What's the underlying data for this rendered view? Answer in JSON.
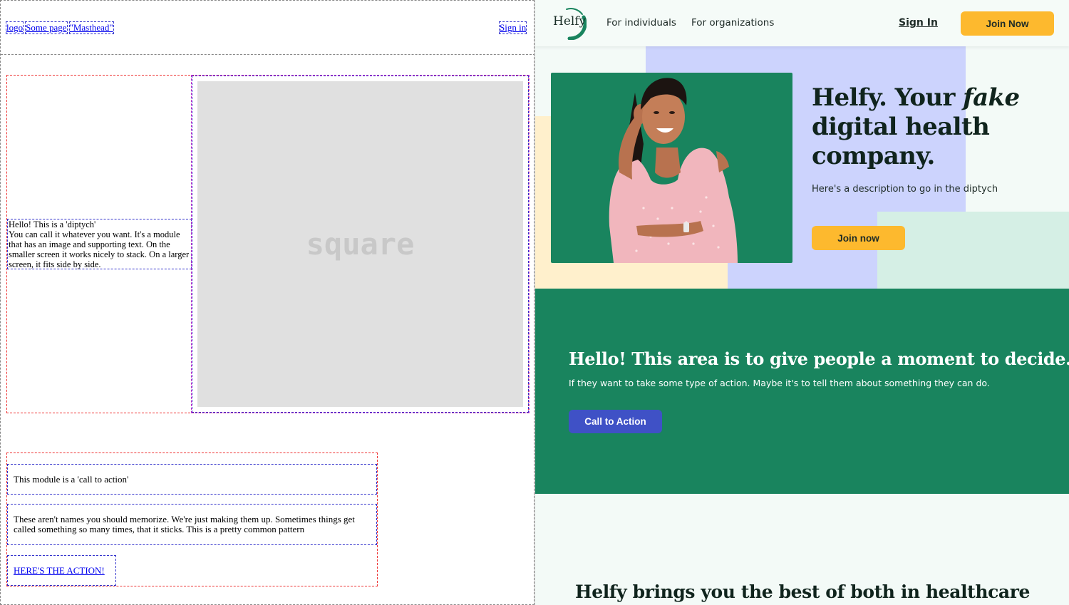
{
  "wireframe": {
    "nav": [
      "logo",
      "Some page",
      "\"Masthead\""
    ],
    "sign_in": "Sign in",
    "diptych_text": "Hello! This is a 'diptych'\nYou can call it whatever you want. It's a module that has an image and supporting text. On the smaller screen it works nicely to stack. On a larger screen, it fits side by side.",
    "square_label": "square",
    "cta_title": "This module is a 'call to action'",
    "cta_body": "These aren't names you should memorize. We're just making them up. Sometimes things get called something so many times, that it sticks. This is a pretty common pattern",
    "cta_link": "HERE'S THE ACTION!"
  },
  "site": {
    "logo_text": "Helfy",
    "nav": [
      "For individuals",
      "For organizations"
    ],
    "sign_in": "Sign In",
    "join_now": "Join Now",
    "hero": {
      "title_prefix": "Helfy. Your ",
      "title_em": "fake",
      "title_suffix": " digital health company.",
      "description": "Here's a description to go in the diptych",
      "button": "Join now"
    },
    "band": {
      "title": "Hello! This area is to give people a moment to decide...",
      "subtitle": "If they want to take some type of action. Maybe it's to tell them about something they can do.",
      "button": "Call to Action"
    },
    "bottom_title": "Helfy brings you the best of both in healthcare",
    "colors": {
      "green": "#19845e",
      "yellow": "#fdb92e",
      "lavender": "#ccd3fd",
      "cream": "#fff0cc",
      "mint": "#d5efe5",
      "cta_blue": "#3f51c6"
    }
  }
}
